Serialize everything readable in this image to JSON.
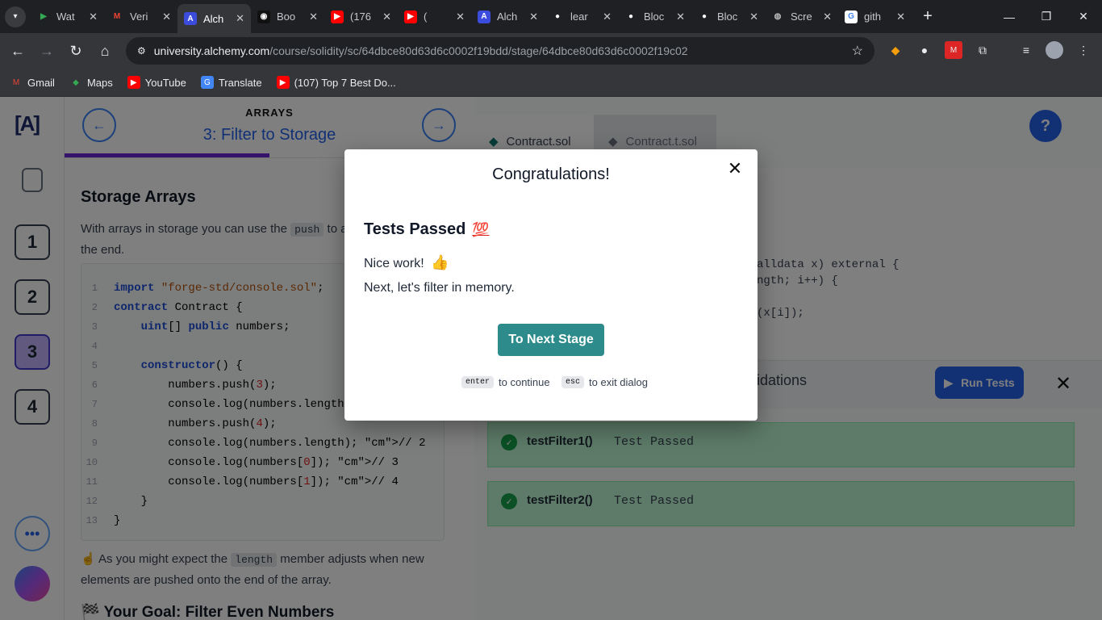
{
  "browser": {
    "tabs": [
      {
        "title": "Wat",
        "icon": "play-icon",
        "active": false
      },
      {
        "title": "Veri",
        "icon": "gmail-icon",
        "active": false
      },
      {
        "title": "Alch",
        "icon": "alchemy-icon",
        "active": true
      },
      {
        "title": "Boo",
        "icon": "bot-icon",
        "active": false
      },
      {
        "title": "(176",
        "icon": "youtube-icon",
        "active": false
      },
      {
        "title": "(",
        "icon": "youtube-icon",
        "active": false
      },
      {
        "title": "Alch",
        "icon": "alchemy-icon",
        "active": false
      },
      {
        "title": "lear",
        "icon": "github-icon",
        "active": false
      },
      {
        "title": "Bloc",
        "icon": "github-icon",
        "active": false
      },
      {
        "title": "Bloc",
        "icon": "github-icon",
        "active": false
      },
      {
        "title": "Scre",
        "icon": "globe-icon",
        "active": false
      },
      {
        "title": "gith",
        "icon": "google-icon",
        "active": false
      }
    ],
    "url_host": "university.alchemy.com",
    "url_path": "/course/solidity/sc/64dbce80d63d6c0002f19bdd/stage/64dbce80d63d6c0002f19c02",
    "bookmarks": [
      {
        "label": "Gmail",
        "icon": "gmail-icon"
      },
      {
        "label": "Maps",
        "icon": "maps-icon"
      },
      {
        "label": "YouTube",
        "icon": "youtube-icon"
      },
      {
        "label": "Translate",
        "icon": "translate-icon"
      },
      {
        "label": "(107) Top 7 Best Do...",
        "icon": "youtube-icon"
      }
    ]
  },
  "sidebar": {
    "logo": "[A]",
    "stages": [
      "1",
      "2",
      "3",
      "4"
    ],
    "current_stage": "3"
  },
  "stage": {
    "category": "ARRAYS",
    "title": "3: Filter to Storage"
  },
  "lesson": {
    "heading": "Storage Arrays",
    "intro_before": "With arrays in storage you can use the",
    "intro_code": "push",
    "intro_after": "to add a new element at the end.",
    "code_lines": [
      "import \"forge-std/console.sol\";",
      "contract Contract {",
      "    uint[] public numbers;",
      "",
      "    constructor() {",
      "        numbers.push(3);",
      "        console.log(numbers.length); // 1",
      "        numbers.push(4);",
      "        console.log(numbers.length); // 2",
      "        console.log(numbers[0]); // 3",
      "        console.log(numbers[1]); // 4",
      "    }",
      "}"
    ],
    "after_before": "☝️ As you might expect the",
    "after_code": "length",
    "after_after": "member adjusts when new elements are pushed onto the end of the array.",
    "goal": "🏁 Your Goal: Filter Even Numbers"
  },
  "editor": {
    "tabs": [
      "Contract.sol",
      "Contract.t.sol"
    ],
    "visible_lines": [
      "alldata x) external {",
      "ngth; i++) {",
      "",
      "(x[i]);"
    ]
  },
  "tests": {
    "panel_label": "idations",
    "run_label": "Run Tests",
    "results": [
      {
        "name": "testFilter1()",
        "status": "Test Passed"
      },
      {
        "name": "testFilter2()",
        "status": "Test Passed"
      }
    ]
  },
  "modal": {
    "title": "Congratulations!",
    "heading": "Tests Passed",
    "heading_emoji": "💯",
    "line1": "Nice work!",
    "line1_emoji": "👍",
    "line2": "Next, let's filter in memory.",
    "button": "To Next Stage",
    "hint_enter_key": "enter",
    "hint_enter_text": "to continue",
    "hint_esc_key": "esc",
    "hint_esc_text": "to exit dialog"
  }
}
